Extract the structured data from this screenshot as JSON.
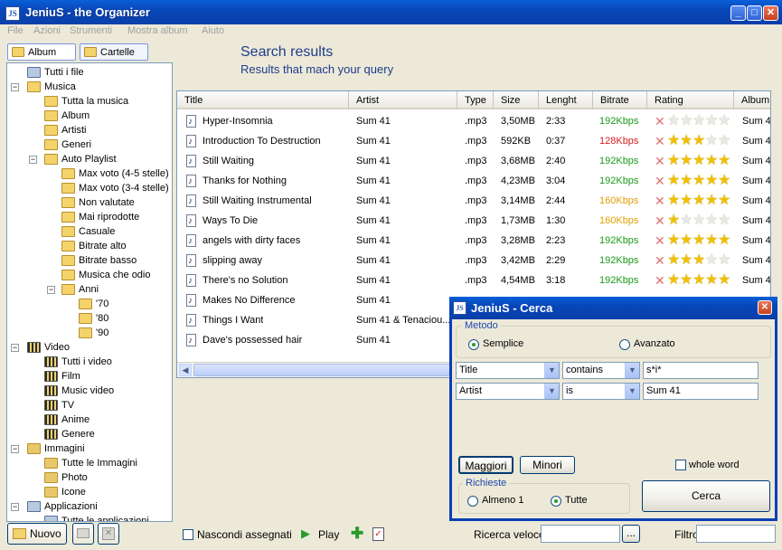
{
  "window": {
    "title": "JeniuS - the Organizer",
    "icon_text": "JS",
    "min": "_",
    "max": "□",
    "close": "✕"
  },
  "menu": [
    "File",
    "Azioni",
    "Strumenti",
    "Mostra album",
    "Aiuto"
  ],
  "left_tabs": {
    "album": "Album",
    "cartelle": "Cartelle"
  },
  "tree": {
    "tutti": "Tutti i file",
    "musica": "Musica",
    "tutta_musica": "Tutta la musica",
    "album": "Album",
    "artisti": "Artisti",
    "generi": "Generi",
    "auto_playlist": "Auto Playlist",
    "max_voto_45": "Max voto (4-5 stelle)",
    "max_voto_34": "Max voto (3-4 stelle)",
    "non_valutate": "Non valutate",
    "mai_riprodotte": "Mai riprodotte",
    "casuale": "Casuale",
    "bitrate_alto": "Bitrate alto",
    "bitrate_basso": "Bitrate basso",
    "musica_odio": "Musica che odio",
    "anni": "Anni",
    "y70": "'70",
    "y80": "'80",
    "y90": "'90",
    "video": "Video",
    "tutti_video": "Tutti i video",
    "film": "Film",
    "music_video": "Music video",
    "tv": "TV",
    "anime": "Anime",
    "genere": "Genere",
    "immagini": "Immagini",
    "tutte_immagini": "Tutte le Immagini",
    "photo": "Photo",
    "icone": "Icone",
    "applicazioni": "Applicazioni",
    "tutte_app": "Tutte le applicazioni"
  },
  "results": {
    "title": "Search results",
    "subtitle": "Results that mach your query"
  },
  "columns": {
    "title": "Title",
    "artist": "Artist",
    "type": "Type",
    "size": "Size",
    "lenght": "Lenght",
    "bitrate": "Bitrate",
    "rating": "Rating",
    "album": "Album"
  },
  "rows": [
    {
      "title": "Hyper-Insomnia",
      "artist": "Sum 41",
      "type": ".mp3",
      "size": "3,50MB",
      "len": "2:33",
      "bitrate": "192Kbps",
      "bcolor": "#1a9a1a",
      "rating": 0,
      "album": "Sum 4"
    },
    {
      "title": "Introduction To Destruction",
      "artist": "Sum 41",
      "type": ".mp3",
      "size": "592KB",
      "len": "0:37",
      "bitrate": "128Kbps",
      "bcolor": "#d42020",
      "rating": 3,
      "album": "Sum 4"
    },
    {
      "title": "Still Waiting",
      "artist": "Sum 41",
      "type": ".mp3",
      "size": "3,68MB",
      "len": "2:40",
      "bitrate": "192Kbps",
      "bcolor": "#1a9a1a",
      "rating": 5,
      "album": "Sum 4"
    },
    {
      "title": "Thanks for Nothing",
      "artist": "Sum 41",
      "type": ".mp3",
      "size": "4,23MB",
      "len": "3:04",
      "bitrate": "192Kbps",
      "bcolor": "#1a9a1a",
      "rating": 5,
      "album": "Sum 4"
    },
    {
      "title": "Still Waiting Instrumental",
      "artist": "Sum 41",
      "type": ".mp3",
      "size": "3,14MB",
      "len": "2:44",
      "bitrate": "160Kbps",
      "bcolor": "#e0a000",
      "rating": 5,
      "album": "Sum 4"
    },
    {
      "title": "Ways To Die",
      "artist": "Sum 41",
      "type": ".mp3",
      "size": "1,73MB",
      "len": "1:30",
      "bitrate": "160Kbps",
      "bcolor": "#e0a000",
      "rating": 1,
      "album": "Sum 4"
    },
    {
      "title": "angels with dirty faces",
      "artist": "Sum 41",
      "type": ".mp3",
      "size": "3,28MB",
      "len": "2:23",
      "bitrate": "192Kbps",
      "bcolor": "#1a9a1a",
      "rating": 5,
      "album": "Sum 4"
    },
    {
      "title": "slipping away",
      "artist": "Sum 41",
      "type": ".mp3",
      "size": "3,42MB",
      "len": "2:29",
      "bitrate": "192Kbps",
      "bcolor": "#1a9a1a",
      "rating": 3,
      "album": "Sum 4"
    },
    {
      "title": "There's no Solution",
      "artist": "Sum 41",
      "type": ".mp3",
      "size": "4,54MB",
      "len": "3:18",
      "bitrate": "192Kbps",
      "bcolor": "#1a9a1a",
      "rating": 5,
      "album": "Sum 4"
    },
    {
      "title": "Makes No Difference",
      "artist": "Sum 41",
      "type": "",
      "size": "",
      "len": "",
      "bitrate": "",
      "bcolor": "#1a9a1a",
      "rating": -1,
      "album": ""
    },
    {
      "title": "Things I Want",
      "artist": "Sum 41 & Tenaciou...",
      "type": "",
      "size": "",
      "len": "",
      "bitrate": "",
      "bcolor": "#1a9a1a",
      "rating": -1,
      "album": ""
    },
    {
      "title": "Dave's possessed hair",
      "artist": "Sum 41",
      "type": "",
      "size": "",
      "len": "",
      "bitrate": "",
      "bcolor": "#1a9a1a",
      "rating": -1,
      "album": ""
    }
  ],
  "bottom": {
    "nuovo": "Nuovo",
    "nascondi": "Nascondi assegnati",
    "play": "Play",
    "ricerca": "Ricerca veloce",
    "browse": "...",
    "filtro": "Filtro"
  },
  "dialog": {
    "title": "JeniuS - Cerca",
    "metodo": "Metodo",
    "semplice": "Semplice",
    "avanzato": "Avanzato",
    "field1": "Title",
    "op1": "contains",
    "val1": "s*i*",
    "field2": "Artist",
    "op2": "is",
    "val2": "Sum 41",
    "maggiori": "Maggiori",
    "minori": "Minori",
    "whole_word": "whole word",
    "richieste": "Richieste",
    "almeno": "Almeno 1",
    "tutte": "Tutte",
    "cerca": "Cerca"
  },
  "colors": {
    "star_on": "#f0c000",
    "star_off": "#e8e8e8",
    "accent": "#1e3c8c"
  }
}
